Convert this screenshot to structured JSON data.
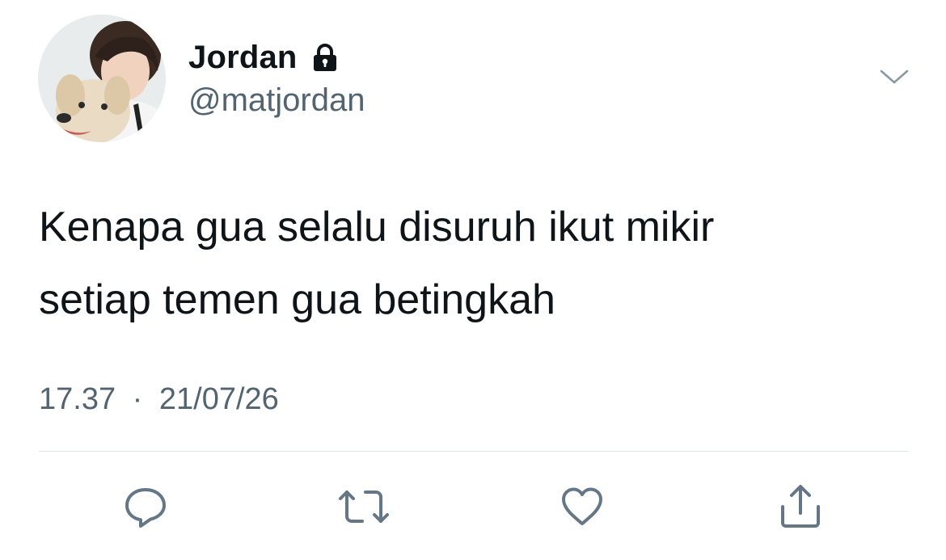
{
  "user": {
    "display_name": "Jordan",
    "handle": "@matjordan",
    "protected_icon": "lock-icon",
    "avatar": "avatar-photo"
  },
  "tweet": {
    "text_lines": [
      "Kenapa gua selalu disuruh ikut mikir",
      "setiap temen gua betingkah"
    ],
    "time": "17.37",
    "separator": "·",
    "date": "21/07/26"
  },
  "actions": [
    {
      "name": "reply",
      "icon": "reply-icon"
    },
    {
      "name": "retweet",
      "icon": "retweet-icon"
    },
    {
      "name": "like",
      "icon": "heart-icon"
    },
    {
      "name": "share",
      "icon": "share-icon"
    }
  ],
  "colors": {
    "text_primary": "#0f1419",
    "text_secondary": "#536471",
    "icon_gray": "#657786",
    "divider": "#e1e6ea"
  }
}
